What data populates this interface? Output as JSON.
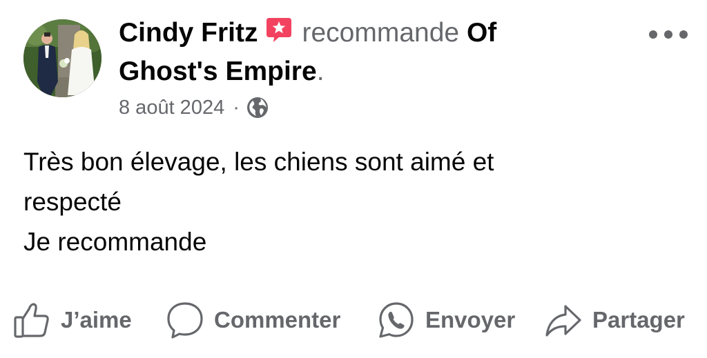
{
  "post": {
    "author": "Cindy Fritz",
    "verb": "recommande",
    "page_line1": "Of",
    "page_line2": "Ghost's Empire",
    "period": ".",
    "date": "8 août 2024",
    "separator": "·",
    "icons": {
      "recommend": "recommend-badge-icon",
      "audience": "globe-icon",
      "more": "more-options-icon"
    },
    "text_lines": [
      "Très bon élevage, les chiens sont aimé et",
      "respecté",
      "Je recommande"
    ]
  },
  "actions": {
    "like": "J’aime",
    "comment": "Commenter",
    "send": "Envoyer",
    "share": "Partager"
  },
  "colors": {
    "primary_text": "#050505",
    "secondary_text": "#65676b",
    "recommend_badge": "#f3425f",
    "background": "#ffffff"
  }
}
